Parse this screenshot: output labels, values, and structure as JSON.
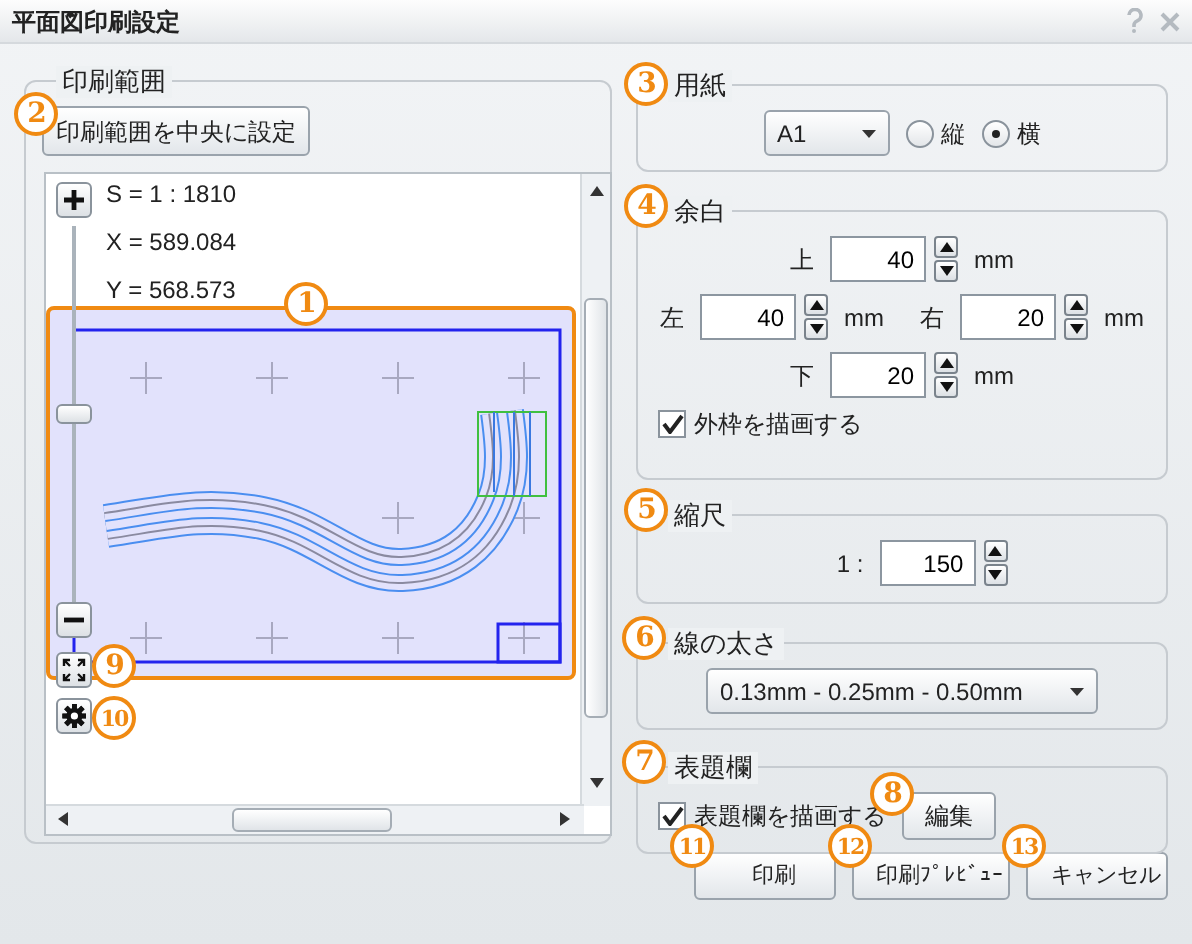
{
  "window": {
    "title": "平面図印刷設定"
  },
  "print_range": {
    "title": "印刷範囲",
    "center_button": "印刷範囲を中央に設定",
    "readouts": [
      "S = 1 : 1810",
      "X = 589.084",
      "Y = 568.573"
    ],
    "zoom": {
      "level": 0.5
    }
  },
  "paper": {
    "title": "用紙",
    "size": "A1",
    "orientations": [
      {
        "label": "縦",
        "selected": false
      },
      {
        "label": "横",
        "selected": true
      }
    ]
  },
  "margins": {
    "title": "余白",
    "fields": [
      {
        "label": "上",
        "value": "40",
        "unit": "mm"
      },
      {
        "label": "左",
        "value": "40",
        "unit": "mm"
      },
      {
        "label": "右",
        "value": "20",
        "unit": "mm"
      },
      {
        "label": "下",
        "value": "20",
        "unit": "mm"
      }
    ],
    "draw_frame": {
      "label": "外枠を描画する",
      "checked": true
    }
  },
  "scale": {
    "title": "縮尺",
    "prefix": "1 :",
    "value": "150"
  },
  "line_width": {
    "title": "線の太さ",
    "value": "0.13mm - 0.25mm - 0.50mm"
  },
  "title_block": {
    "title": "表題欄",
    "draw": {
      "label": "表題欄を描画する",
      "checked": true
    },
    "edit_button": "編集"
  },
  "buttons": [
    "印刷",
    "印刷ﾌﾟﾚﾋﾞｭｰ",
    "キャンセル"
  ],
  "callouts": [
    "1",
    "2",
    "3",
    "4",
    "5",
    "6",
    "7",
    "8",
    "9",
    "10",
    "11",
    "12",
    "13"
  ]
}
